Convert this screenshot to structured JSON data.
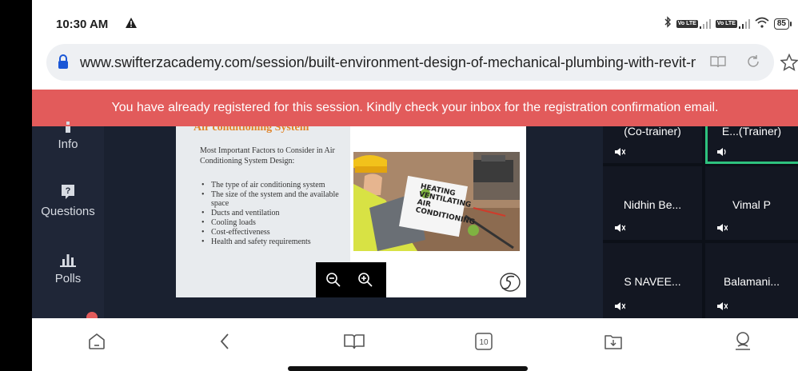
{
  "status_bar": {
    "time": "10:30 AM",
    "battery": "85",
    "volte_label": "Vo LTE"
  },
  "browser": {
    "url": "www.swifterzacademy.com/session/built-environment-design-of-mechanical-plumbing-with-revit-mep-–"
  },
  "alert": {
    "message": "You have already registered for this session. Kindly check your inbox for the registration confirmation email.",
    "color": "#e25b5b"
  },
  "sidebar": {
    "items": [
      {
        "label": "Info",
        "icon": "info-icon"
      },
      {
        "label": "Questions",
        "icon": "question-bubble-icon"
      },
      {
        "label": "Polls",
        "icon": "bar-chart-icon"
      }
    ]
  },
  "slide": {
    "title": "Air conditioning System",
    "intro": "Most Important Factors to Consider in Air Conditioning System Design:",
    "bullets": [
      "The type of air conditioning system",
      "The size of the system and the available space",
      "Ducts and ventilation",
      "Cooling loads",
      "Cost-effectiveness",
      "Health and safety requirements"
    ],
    "sign_lines": [
      "HEATING",
      "VENTILATING",
      "AIR",
      "CONDITIONING"
    ]
  },
  "participants": [
    {
      "name": "(Co-trainer)",
      "mic": "muted"
    },
    {
      "name": "E...(Trainer)",
      "mic": "speaking"
    },
    {
      "name": "Nidhin Be...",
      "mic": "muted"
    },
    {
      "name": "Vimal P",
      "mic": "muted"
    },
    {
      "name": "S NAVEE...",
      "mic": "muted"
    },
    {
      "name": "Balamani...",
      "mic": "muted"
    }
  ],
  "bottom_nav": {
    "tabs_count": "10",
    "items": [
      "home-icon",
      "back-icon",
      "bookmarks-icon",
      "tabs-icon",
      "downloads-icon",
      "profile-icon"
    ]
  },
  "colors": {
    "accent_green": "#2ec27e",
    "slide_title": "#e08226",
    "sidebar_bg": "#1f2637"
  }
}
